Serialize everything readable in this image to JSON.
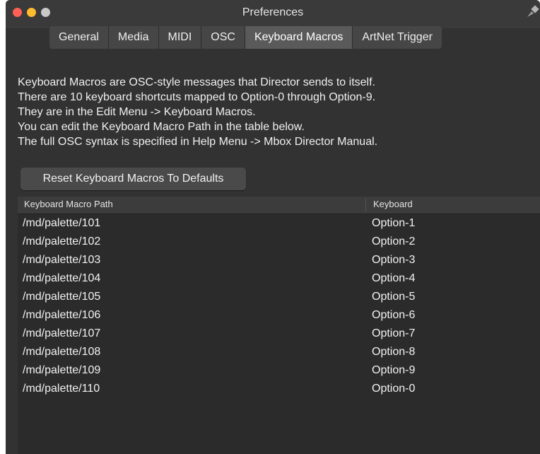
{
  "window": {
    "title": "Preferences"
  },
  "tabs": [
    {
      "label": "General",
      "active": false
    },
    {
      "label": "Media",
      "active": false
    },
    {
      "label": "MIDI",
      "active": false
    },
    {
      "label": "OSC",
      "active": false
    },
    {
      "label": "Keyboard Macros",
      "active": true
    },
    {
      "label": "ArtNet Trigger",
      "active": false
    }
  ],
  "description": [
    "Keyboard Macros are OSC-style messages that Director sends to itself.",
    "There are 10 keyboard shortcuts mapped to Option-0 through Option-9.",
    "They are in the Edit Menu -> Keyboard Macros.",
    "You can edit the Keyboard Macro Path in the table below.",
    "The full OSC syntax is specified in Help Menu -> Mbox Director Manual."
  ],
  "reset_button": {
    "label": "Reset Keyboard Macros To Defaults"
  },
  "table": {
    "headers": {
      "path": "Keyboard Macro Path",
      "keyboard": "Keyboard"
    },
    "rows": [
      {
        "path": "/md/palette/101",
        "keyboard": "Option-1"
      },
      {
        "path": "/md/palette/102",
        "keyboard": "Option-2"
      },
      {
        "path": "/md/palette/103",
        "keyboard": "Option-3"
      },
      {
        "path": "/md/palette/104",
        "keyboard": "Option-4"
      },
      {
        "path": "/md/palette/105",
        "keyboard": "Option-5"
      },
      {
        "path": "/md/palette/106",
        "keyboard": "Option-6"
      },
      {
        "path": "/md/palette/107",
        "keyboard": "Option-7"
      },
      {
        "path": "/md/palette/108",
        "keyboard": "Option-8"
      },
      {
        "path": "/md/palette/109",
        "keyboard": "Option-9"
      },
      {
        "path": "/md/palette/110",
        "keyboard": "Option-0"
      }
    ]
  },
  "colors": {
    "window_bg": "#323232",
    "close": "#ff5f57",
    "minimize": "#febc2e",
    "zoom": "#c8c8c8"
  }
}
